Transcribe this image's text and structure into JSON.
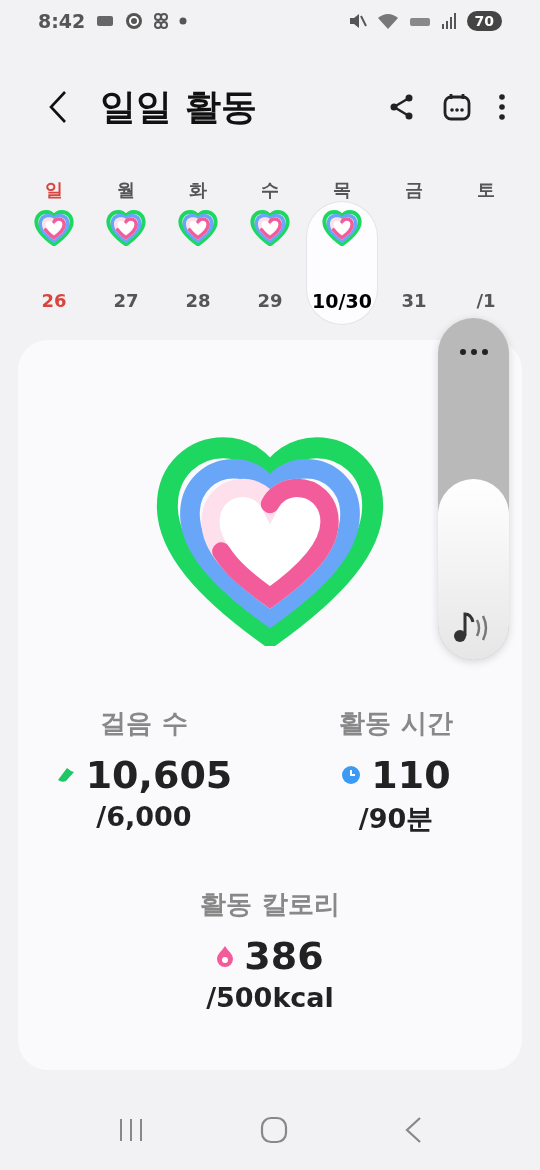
{
  "status_bar": {
    "time": "8:42",
    "battery": "70"
  },
  "header": {
    "title": "일일 활동"
  },
  "days": [
    {
      "weekday": "일",
      "date": "26",
      "holiday": true,
      "activity": true,
      "selected": false
    },
    {
      "weekday": "월",
      "date": "27",
      "holiday": false,
      "activity": true,
      "selected": false
    },
    {
      "weekday": "화",
      "date": "28",
      "holiday": false,
      "activity": true,
      "selected": false
    },
    {
      "weekday": "수",
      "date": "29",
      "holiday": false,
      "activity": true,
      "selected": false
    },
    {
      "weekday": "목",
      "date": "10/30",
      "holiday": false,
      "activity": true,
      "selected": true
    },
    {
      "weekday": "금",
      "date": "31",
      "holiday": false,
      "activity": false,
      "selected": false
    },
    {
      "weekday": "토",
      "date": "/1",
      "holiday": false,
      "activity": false,
      "selected": false
    }
  ],
  "stats": [
    {
      "kind": "steps",
      "label": "걸음 수",
      "value": "10,605",
      "goal": "/6,000"
    },
    {
      "kind": "time",
      "label": "활동 시간",
      "value": "110",
      "goal": "/90분"
    },
    {
      "kind": "calories",
      "label": "활동 칼로리",
      "value": "386",
      "goal": "/500kcal"
    }
  ],
  "volume_panel": {
    "level": 0.53
  }
}
